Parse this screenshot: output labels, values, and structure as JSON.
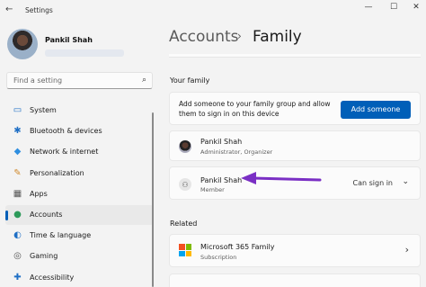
{
  "window": {
    "title": "Settings",
    "back_glyph": "←",
    "minimize_glyph": "—",
    "maximize_glyph": "☐",
    "close_glyph": "✕"
  },
  "profile": {
    "name": "Pankil Shah"
  },
  "search": {
    "placeholder": "Find a setting",
    "icon": "search-icon"
  },
  "sidebar": {
    "items": [
      {
        "label": "System",
        "icon": "system-icon",
        "glyph": "▭",
        "color": "#1f6fc5"
      },
      {
        "label": "Bluetooth & devices",
        "icon": "bluetooth-icon",
        "glyph": "✱",
        "color": "#1f6fc5"
      },
      {
        "label": "Network & internet",
        "icon": "network-icon",
        "glyph": "◆",
        "color": "#2f8fe0"
      },
      {
        "label": "Personalization",
        "icon": "personalization-icon",
        "glyph": "✎",
        "color": "#d08a2c"
      },
      {
        "label": "Apps",
        "icon": "apps-icon",
        "glyph": "▦",
        "color": "#555555"
      },
      {
        "label": "Accounts",
        "icon": "accounts-icon",
        "glyph": "●",
        "color": "#2d9a5a",
        "active": true
      },
      {
        "label": "Time & language",
        "icon": "time-language-icon",
        "glyph": "◐",
        "color": "#1f6fc5"
      },
      {
        "label": "Gaming",
        "icon": "gaming-icon",
        "glyph": "◎",
        "color": "#555555"
      },
      {
        "label": "Accessibility",
        "icon": "accessibility-icon",
        "glyph": "✚",
        "color": "#1f6fc5"
      }
    ]
  },
  "breadcrumb": {
    "parent": "Accounts",
    "separator": "›",
    "current": "Family"
  },
  "family": {
    "section_label": "Your family",
    "add_description": "Add someone to your family group and allow them to sign in on this device",
    "add_button_label": "Add someone",
    "members": [
      {
        "name": "Pankil Shah",
        "role": "Administrator, Organizer",
        "avatar": "photo"
      },
      {
        "name": "Pankil Shah",
        "role": "Member",
        "avatar": "generic",
        "status": "Can sign in"
      }
    ]
  },
  "related": {
    "section_label": "Related",
    "items": [
      {
        "title": "Microsoft 365 Family",
        "subtitle": "Subscription",
        "icon": "microsoft-logo-icon"
      }
    ]
  },
  "colors": {
    "accent": "#005fb8",
    "annotation_arrow": "#7a2fc4",
    "ms_red": "#f25022",
    "ms_green": "#7fba00",
    "ms_blue": "#00a4ef",
    "ms_yellow": "#ffb900"
  }
}
